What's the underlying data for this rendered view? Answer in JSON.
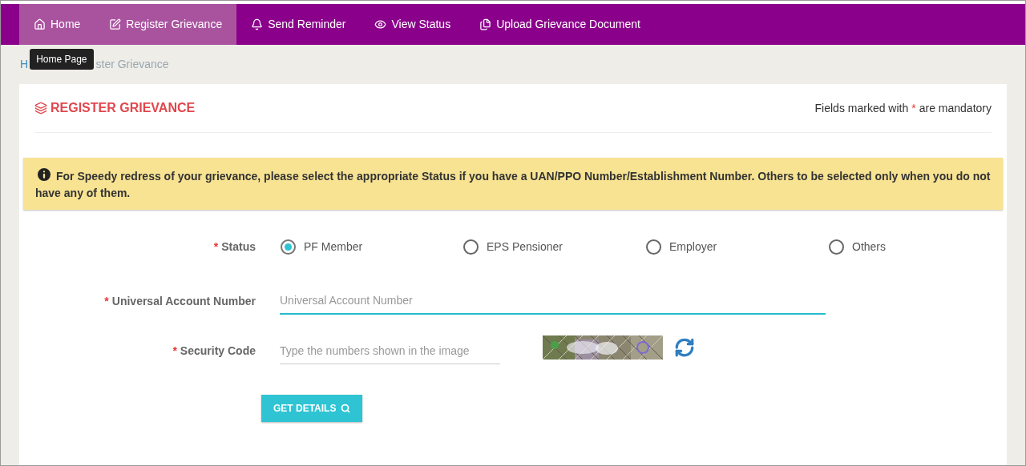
{
  "nav": [
    {
      "label": "Home",
      "highlighted": true
    },
    {
      "label": "Register Grievance",
      "highlighted": true
    },
    {
      "label": "Send Reminder",
      "highlighted": false
    },
    {
      "label": "View Status",
      "highlighted": false
    },
    {
      "label": "Upload Grievance Document",
      "highlighted": false
    }
  ],
  "tooltip": "Home Page",
  "breadcrumb": [
    "H",
    "ster Grievance"
  ],
  "card": {
    "title": "REGISTER GRIEVANCE",
    "mandatory_note": {
      "before": "Fields marked with",
      "mark": "*",
      "after": "are mandatory"
    },
    "alert": "For Speedy redress of your grievance, please select the appropriate Status if you have a UAN/PPO Number/Establishment Number. Others to be selected only when you do not have any of them.",
    "status": {
      "required_mark": "*",
      "label": "Status",
      "options": [
        {
          "label": "PF Member",
          "selected": true
        },
        {
          "label": "EPS Pensioner",
          "selected": false
        },
        {
          "label": "Employer",
          "selected": false
        },
        {
          "label": "Others",
          "selected": false
        }
      ]
    },
    "uan": {
      "required_mark": "*",
      "label": "Universal Account Number",
      "placeholder": "Universal Account Number",
      "focused": true
    },
    "security": {
      "required_mark": "*",
      "label": "Security Code",
      "placeholder": "Type the numbers shown in the image"
    },
    "button": "GET DETAILS"
  }
}
